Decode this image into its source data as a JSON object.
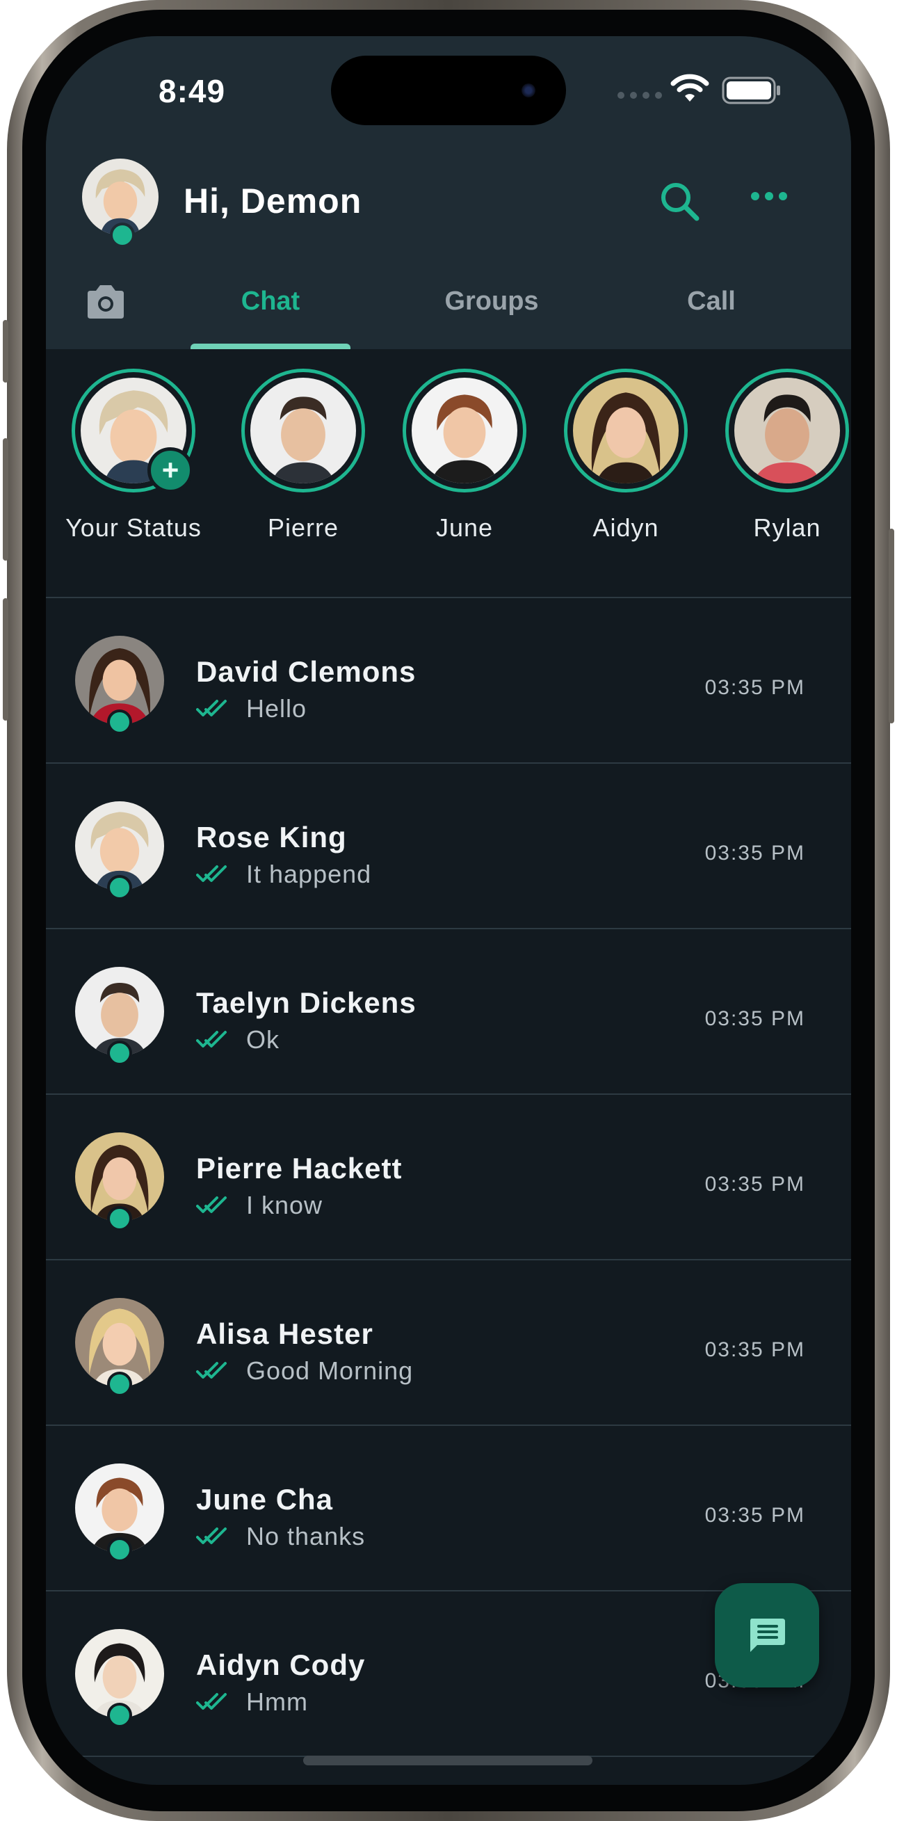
{
  "status_bar": {
    "time": "8:49"
  },
  "header": {
    "greeting": "Hi, Demon"
  },
  "tabs": [
    {
      "label": "Chat",
      "active": true
    },
    {
      "label": "Groups",
      "active": false
    },
    {
      "label": "Call",
      "active": false
    }
  ],
  "stories": [
    {
      "name": "Your Status",
      "add": true
    },
    {
      "name": "Pierre"
    },
    {
      "name": "June"
    },
    {
      "name": "Aidyn"
    },
    {
      "name": "Rylan"
    }
  ],
  "chats": [
    {
      "name": "David Clemons",
      "message": "Hello",
      "time": "03:35 PM"
    },
    {
      "name": "Rose King",
      "message": "It happend",
      "time": "03:35 PM"
    },
    {
      "name": "Taelyn Dickens",
      "message": "Ok",
      "time": "03:35 PM"
    },
    {
      "name": "Pierre Hackett",
      "message": "I know",
      "time": "03:35 PM"
    },
    {
      "name": "Alisa Hester",
      "message": "Good Morning",
      "time": "03:35 PM"
    },
    {
      "name": "June Cha",
      "message": "No thanks",
      "time": "03:35 PM"
    },
    {
      "name": "Aidyn Cody",
      "message": "Hmm",
      "time": "03:35 PM"
    }
  ],
  "colors": {
    "accent": "#1eb690",
    "header_bg": "#1f2c34",
    "body_bg": "#121a20",
    "fab_bg": "#0e5b49"
  },
  "icons": [
    "search-icon",
    "more-icon",
    "camera-icon",
    "double-check-icon",
    "message-icon",
    "wifi-icon",
    "battery-icon"
  ]
}
